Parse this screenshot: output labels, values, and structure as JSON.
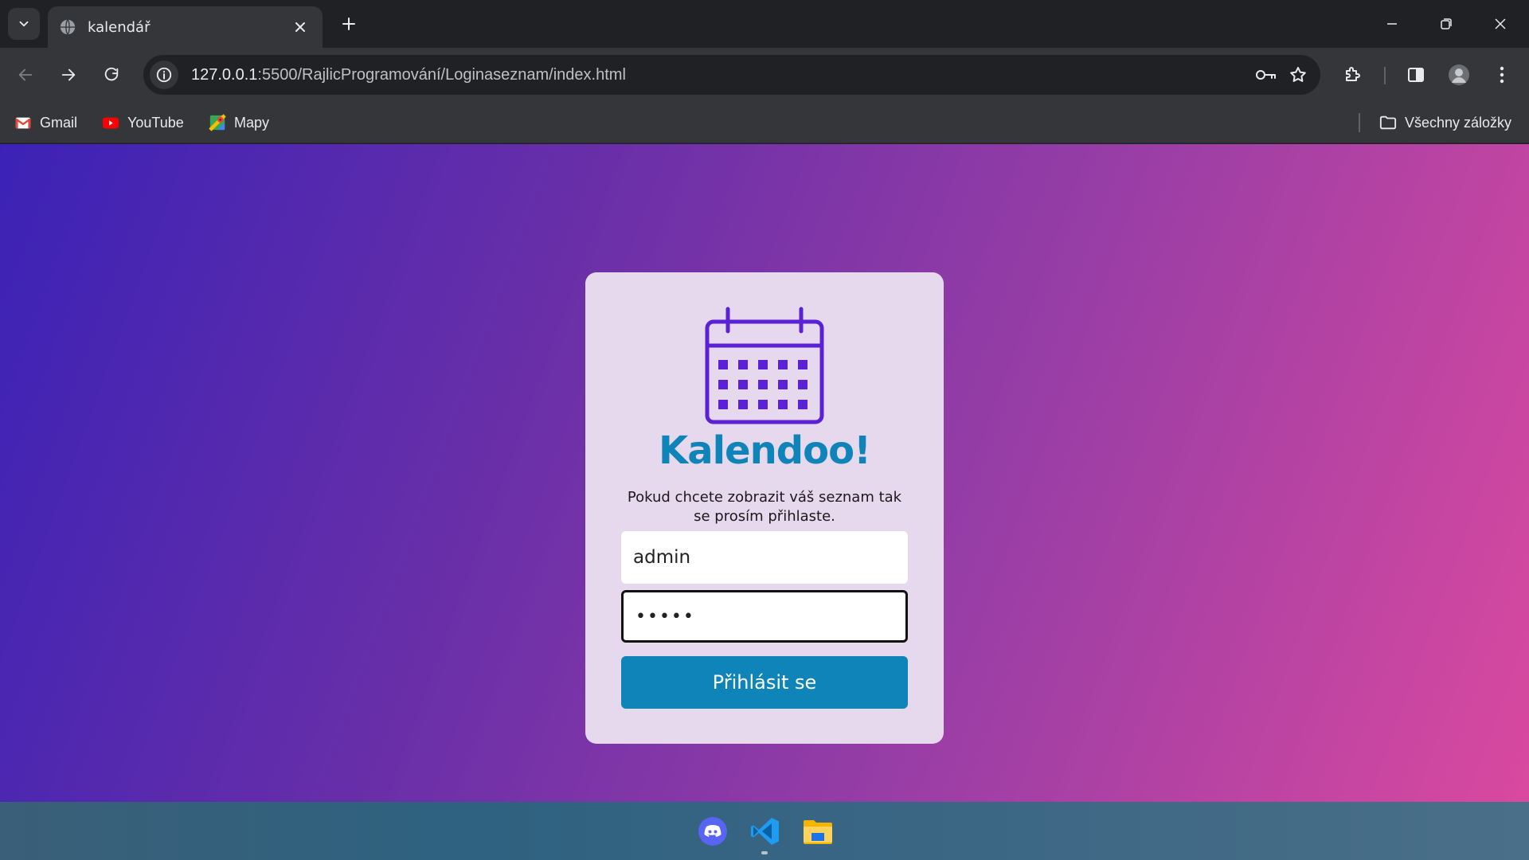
{
  "browser": {
    "tab_title": "kalendář",
    "url_host": "127.0.0.1",
    "url_path": ":5500/RajlicProgramování/Loginaseznam/index.html",
    "bookmarks": [
      {
        "label": "Gmail",
        "icon": "gmail-icon"
      },
      {
        "label": "YouTube",
        "icon": "youtube-icon"
      },
      {
        "label": "Mapy",
        "icon": "maps-icon"
      }
    ],
    "all_bookmarks_label": "Všechny záložky"
  },
  "login": {
    "brand": "Kalendoo!",
    "subtitle": "Pokud chcete zobrazit váš seznam tak se prosím přihlaste.",
    "username_value": "admin",
    "password_value": "•••••",
    "button_label": "Přihlásit se",
    "icon": "calendar-icon"
  },
  "colors": {
    "accent": "#0f84b8",
    "icon_purple": "#5b21d6",
    "card_bg": "#e6d9ee",
    "gradient_start": "#3b22b6",
    "gradient_end": "#d9499f"
  },
  "taskbar": {
    "apps": [
      "discord-icon",
      "vscode-icon",
      "file-explorer-icon"
    ]
  }
}
